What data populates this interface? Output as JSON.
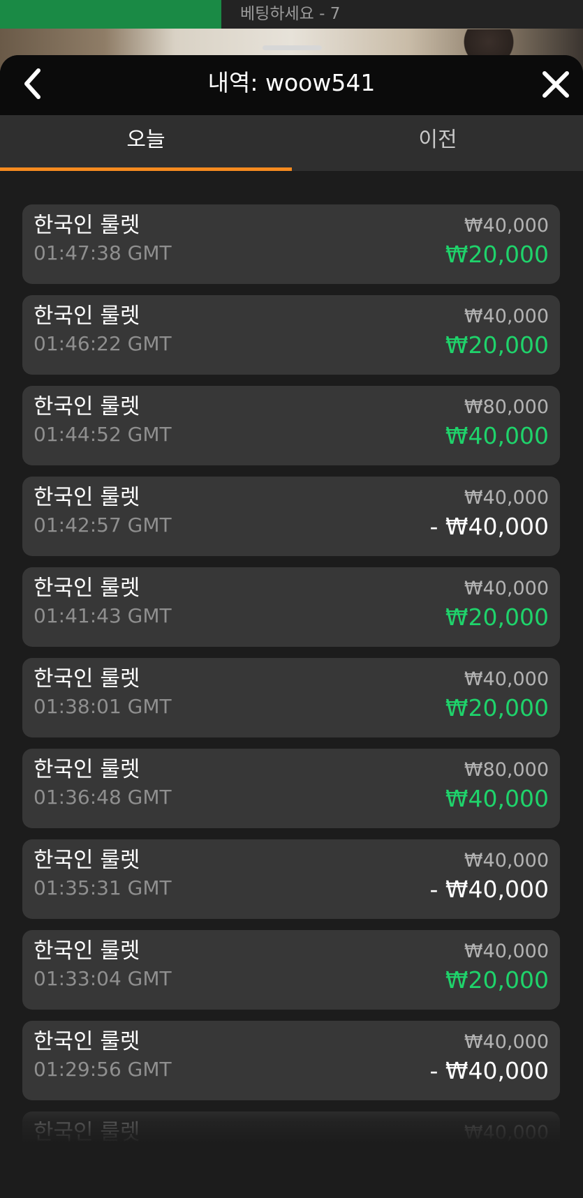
{
  "status_bar": {
    "timer_label": "베팅하세요 - 7",
    "timer_progress": 0.38,
    "timer_color": "#1a8a45"
  },
  "header": {
    "title": "내역: woow541",
    "back_icon": "chevron-left-icon",
    "close_icon": "close-icon"
  },
  "tabs": [
    {
      "label": "오늘",
      "active": true
    },
    {
      "label": "이전",
      "active": false
    }
  ],
  "accent_color": "#f58a1f",
  "win_color": "#1fd36b",
  "history": [
    {
      "game": "한국인 룰렛",
      "time": "01:47:38 GMT",
      "bet": "₩40,000",
      "result": "₩20,000",
      "outcome": "win"
    },
    {
      "game": "한국인 룰렛",
      "time": "01:46:22 GMT",
      "bet": "₩40,000",
      "result": "₩20,000",
      "outcome": "win"
    },
    {
      "game": "한국인 룰렛",
      "time": "01:44:52 GMT",
      "bet": "₩80,000",
      "result": "₩40,000",
      "outcome": "win"
    },
    {
      "game": "한국인 룰렛",
      "time": "01:42:57 GMT",
      "bet": "₩40,000",
      "result": "- ₩40,000",
      "outcome": "loss"
    },
    {
      "game": "한국인 룰렛",
      "time": "01:41:43 GMT",
      "bet": "₩40,000",
      "result": "₩20,000",
      "outcome": "win"
    },
    {
      "game": "한국인 룰렛",
      "time": "01:38:01 GMT",
      "bet": "₩40,000",
      "result": "₩20,000",
      "outcome": "win"
    },
    {
      "game": "한국인 룰렛",
      "time": "01:36:48 GMT",
      "bet": "₩80,000",
      "result": "₩40,000",
      "outcome": "win"
    },
    {
      "game": "한국인 룰렛",
      "time": "01:35:31 GMT",
      "bet": "₩40,000",
      "result": "- ₩40,000",
      "outcome": "loss"
    },
    {
      "game": "한국인 룰렛",
      "time": "01:33:04 GMT",
      "bet": "₩40,000",
      "result": "₩20,000",
      "outcome": "win"
    },
    {
      "game": "한국인 룰렛",
      "time": "01:29:56 GMT",
      "bet": "₩40,000",
      "result": "- ₩40,000",
      "outcome": "loss"
    },
    {
      "game": "한국인 룰렛",
      "time": "",
      "bet": "₩40,000",
      "result": "",
      "outcome": ""
    }
  ]
}
